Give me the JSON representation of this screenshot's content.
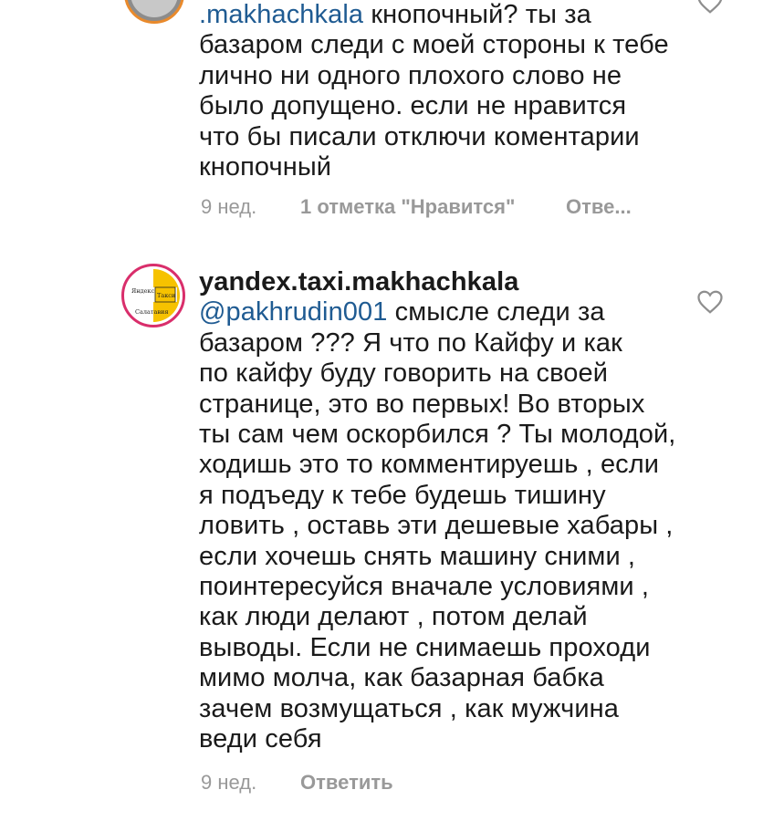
{
  "comments": [
    {
      "username_prefix": ".makhachkala",
      "lines": [
        "кнопочный? ты за",
        "базаром следи с моей стороны к тебе",
        "лично ни одного плохого слово не",
        "было допущено.  если не нравится",
        "что бы писали отключи коментарии",
        "кнопочный"
      ],
      "time": "9 нед.",
      "likes": "1 отметка \"Нравится\"",
      "reply": "Отве..."
    },
    {
      "username": "yandex.taxi.makhachkala",
      "mention": "@pakhrudin001",
      "avatar_text": [
        "Яндекс",
        "Такси",
        "Салатавия"
      ],
      "lines": [
        "смысле следи за",
        "базаром ??? Я что по Кайфу и как",
        "по кайфу буду говорить на своей",
        "странице, это во первых! Во вторых",
        "ты сам чем оскорбился ? Ты молодой,",
        "ходишь это то комментируешь , если",
        "я подъеду к тебе будешь тишину",
        "ловить , оставь эти дешевые хабары ,",
        "если хочешь снять машину сними ,",
        "поинтересуйся вначале условиями ,",
        "как люди делают , потом делай",
        "выводы. Если не снимаешь проходи",
        "мимо молча, как базарная бабка",
        "зачем возмущаться , как мужчина",
        "веди себя"
      ],
      "time": "9 нед.",
      "reply": "Ответить"
    }
  ],
  "colors": {
    "mention": "#1f5b92",
    "meta": "#999999",
    "heart": "#8e8e8e"
  },
  "icons": {
    "like": "heart-outline-icon"
  }
}
